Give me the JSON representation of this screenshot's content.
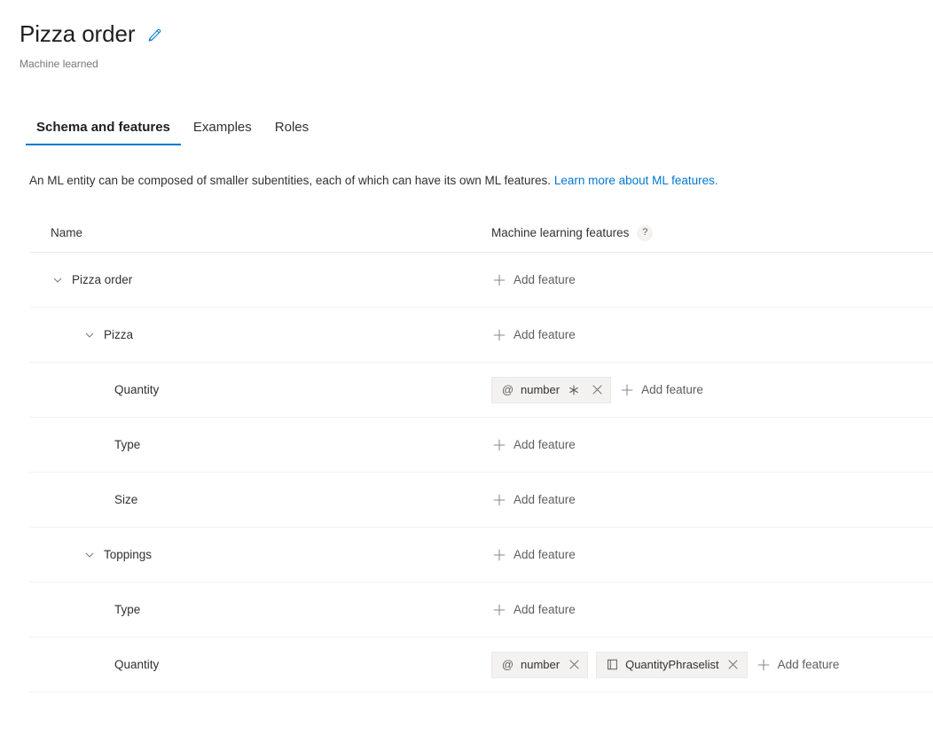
{
  "header": {
    "title": "Pizza order",
    "edit_icon": "pencil-icon",
    "subtitle": "Machine learned",
    "accent_color": "#0078d4"
  },
  "tabs": [
    {
      "label": "Schema and features",
      "active": true
    },
    {
      "label": "Examples",
      "active": false
    },
    {
      "label": "Roles",
      "active": false
    }
  ],
  "description": {
    "text": "An ML entity can be composed of smaller subentities, each of which can have its own ML features.",
    "link_text": "Learn more about ML features.",
    "link_color": "#0078d4"
  },
  "table": {
    "columns": {
      "name": "Name",
      "features": "Machine learning features",
      "help_icon": "question-mark-icon",
      "help_label": "?"
    },
    "add_feature_label": "Add feature",
    "rows": [
      {
        "name": "Pizza order",
        "indent": 0,
        "expandable": true,
        "expanded": true,
        "chips": []
      },
      {
        "name": "Pizza",
        "indent": 1,
        "expandable": true,
        "expanded": true,
        "chips": []
      },
      {
        "name": "Quantity",
        "indent": 2,
        "expandable": false,
        "expanded": false,
        "chips": [
          {
            "label": "number",
            "icon": "at-sign-icon",
            "icon_glyph": "@",
            "required": true,
            "removable": true
          }
        ]
      },
      {
        "name": "Type",
        "indent": 2,
        "expandable": false,
        "expanded": false,
        "chips": []
      },
      {
        "name": "Size",
        "indent": 2,
        "expandable": false,
        "expanded": false,
        "chips": []
      },
      {
        "name": "Toppings",
        "indent": 1,
        "expandable": true,
        "expanded": true,
        "chips": []
      },
      {
        "name": "Type",
        "indent": 2,
        "expandable": false,
        "expanded": false,
        "chips": []
      },
      {
        "name": "Quantity",
        "indent": 2,
        "expandable": false,
        "expanded": false,
        "chips": [
          {
            "label": "number",
            "icon": "at-sign-icon",
            "icon_glyph": "@",
            "required": false,
            "removable": true
          },
          {
            "label": "QuantityPhraselist",
            "icon": "phraselist-book-icon",
            "icon_glyph": "",
            "required": false,
            "removable": true
          }
        ]
      }
    ]
  }
}
